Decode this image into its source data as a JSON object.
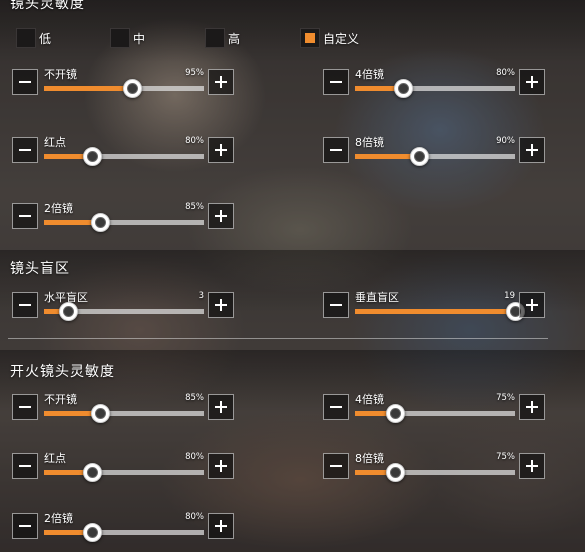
{
  "camera_sensitivity": {
    "title": "镜头灵敏度",
    "presets": [
      {
        "label": "低",
        "selected": false
      },
      {
        "label": "中",
        "selected": false
      },
      {
        "label": "高",
        "selected": false
      },
      {
        "label": "自定义",
        "selected": true
      }
    ],
    "sliders": [
      {
        "label": "不开镜",
        "value": "95%",
        "level": 0.55
      },
      {
        "label": "4倍镜",
        "value": "80%",
        "level": 0.3
      },
      {
        "label": "红点",
        "value": "80%",
        "level": 0.3
      },
      {
        "label": "8倍镜",
        "value": "90%",
        "level": 0.4
      },
      {
        "label": "2倍镜",
        "value": "85%",
        "level": 0.35
      }
    ]
  },
  "dead_zone": {
    "title": "镜头盲区",
    "sliders": [
      {
        "label": "水平盲区",
        "value": "3",
        "level": 0.15
      },
      {
        "label": "垂直盲区",
        "value": "19",
        "level": 1.0
      }
    ]
  },
  "fire_sensitivity": {
    "title": "开火镜头灵敏度",
    "sliders": [
      {
        "label": "不开镜",
        "value": "85%",
        "level": 0.35
      },
      {
        "label": "4倍镜",
        "value": "75%",
        "level": 0.25
      },
      {
        "label": "红点",
        "value": "80%",
        "level": 0.3
      },
      {
        "label": "8倍镜",
        "value": "75%",
        "level": 0.25
      },
      {
        "label": "2倍镜",
        "value": "80%",
        "level": 0.3
      }
    ]
  },
  "colors": {
    "accent": "#f08c2e",
    "track": "#e1e1e1",
    "button_bg": "#0c0c0c"
  }
}
